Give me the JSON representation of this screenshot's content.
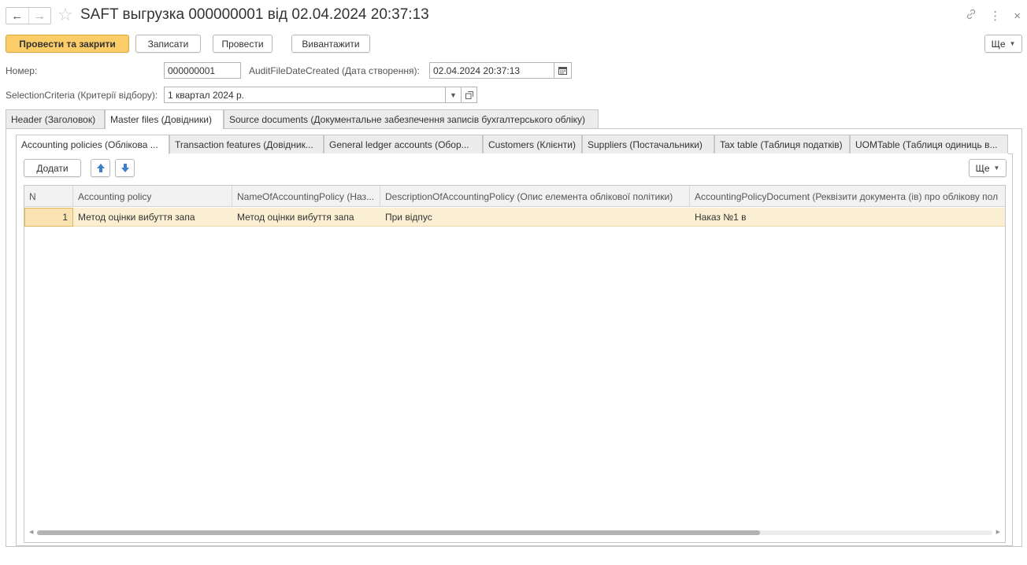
{
  "window": {
    "title": "SAFT выгрузка 000000001 від 02.04.2024 20:37:13",
    "back_glyph": "←",
    "forward_glyph": "→",
    "star_glyph": "☆",
    "link_glyph": "🔗",
    "menu_glyph": "⋮",
    "close_glyph": "×"
  },
  "toolbar": {
    "post_close_label": "Провести та закрити",
    "save_label": "Записати",
    "post_label": "Провести",
    "export_label": "Вивантажити",
    "more_label": "Ще"
  },
  "fields": {
    "number_label": "Номер:",
    "number_value": "000000001",
    "date_label": "AuditFileDateCreated (Дата створення):",
    "date_value": "02.04.2024 20:37:13",
    "criteria_label": "SelectionCriteria (Критерії відбору):",
    "criteria_value": "1 квартал 2024 р."
  },
  "tabs": [
    "Header (Заголовок)",
    "Master files (Довідники)",
    "Source documents (Документальне забезпечення записів бухгалтерського обліку)"
  ],
  "subtabs": [
    "Accounting policies (Облікова ...",
    "Transaction features (Довідник...",
    "General ledger accounts (Обор...",
    "Customers (Клієнти)",
    "Suppliers (Постачальники)",
    "Tax table (Таблиця податків)",
    "UOMTable (Таблиця одиниць в..."
  ],
  "table_toolbar": {
    "add_label": "Додати",
    "more_label": "Ще"
  },
  "table": {
    "columns": [
      "N",
      "Accounting policy",
      "NameOfAccountingPolicy (Наз...",
      "DescriptionOfAccountingPolicy (Опис елемента облікової політики)",
      "AccountingPolicyDocument (Реквізити документа (ів) про облікову пол"
    ],
    "rows": [
      {
        "n": "1",
        "policy": "Метод оцінки вибуття запа",
        "name": "Метод оцінки вибуття запа",
        "description": "При відпус",
        "document": "Наказ №1 в"
      }
    ]
  },
  "colors": {
    "primary_button": "#fbcd68",
    "selected_row": "#fbefd3",
    "move_arrow": "#3d7fcf"
  }
}
